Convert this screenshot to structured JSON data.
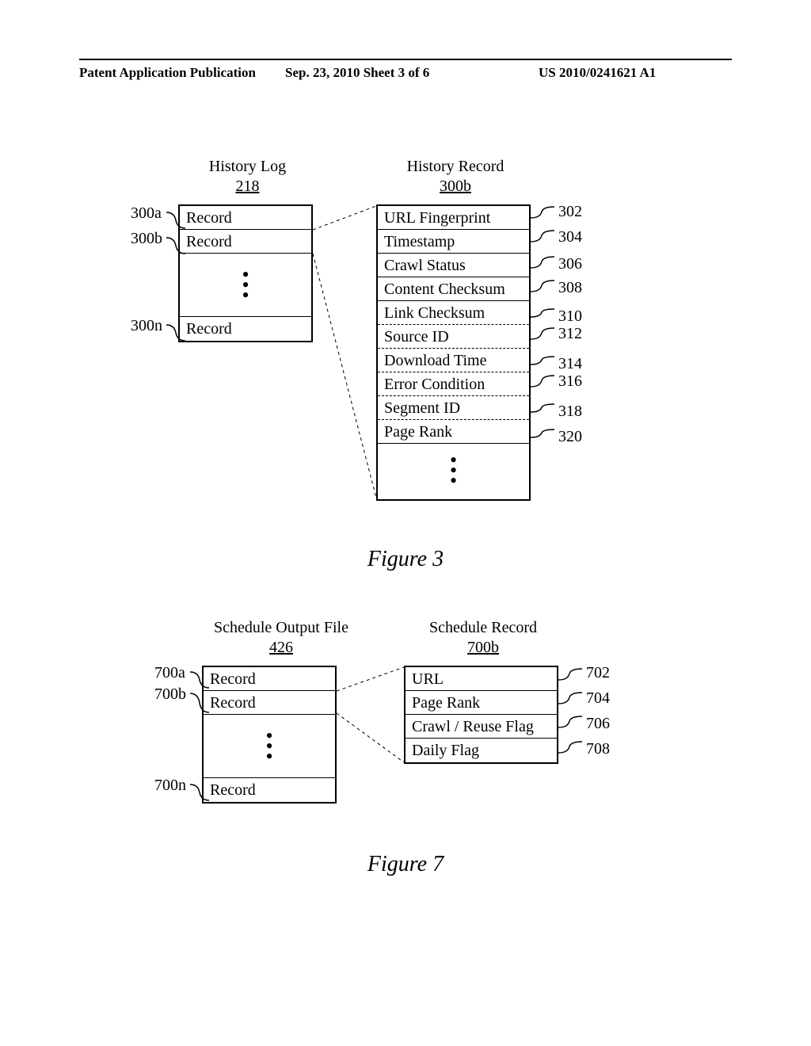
{
  "header": {
    "left": "Patent Application Publication",
    "mid": "Sep. 23, 2010  Sheet 3 of 6",
    "right": "US 2010/0241621 A1"
  },
  "fig3": {
    "leftTitle": "History Log",
    "leftTitleNum": "218",
    "rightTitle": "History Record",
    "rightTitleNum": "300b",
    "leftRows": {
      "r0": "Record",
      "r1": "Record",
      "r2": "Record"
    },
    "leftRefs": {
      "a": "300a",
      "b": "300b",
      "n": "300n"
    },
    "rightRows": {
      "r0": "URL Fingerprint",
      "r1": "Timestamp",
      "r2": "Crawl Status",
      "r3": "Content Checksum",
      "r4": "Link Checksum",
      "r5": "Source ID",
      "r6": "Download Time",
      "r7": "Error Condition",
      "r8": "Segment ID",
      "r9": "Page Rank"
    },
    "rightRefs": {
      "r0": "302",
      "r1": "304",
      "r2": "306",
      "r3": "308",
      "r4": "310",
      "r5": "312",
      "r6": "314",
      "r7": "316",
      "r8": "318",
      "r9": "320"
    },
    "caption": "Figure 3"
  },
  "fig7": {
    "leftTitle": "Schedule Output File",
    "leftTitleNum": "426",
    "rightTitle": "Schedule Record",
    "rightTitleNum": "700b",
    "leftRows": {
      "r0": "Record",
      "r1": "Record",
      "r2": "Record"
    },
    "leftRefs": {
      "a": "700a",
      "b": "700b",
      "n": "700n"
    },
    "rightRows": {
      "r0": "URL",
      "r1": "Page Rank",
      "r2": "Crawl / Reuse Flag",
      "r3": "Daily Flag"
    },
    "rightRefs": {
      "r0": "702",
      "r1": "704",
      "r2": "706",
      "r3": "708"
    },
    "caption": "Figure 7"
  }
}
